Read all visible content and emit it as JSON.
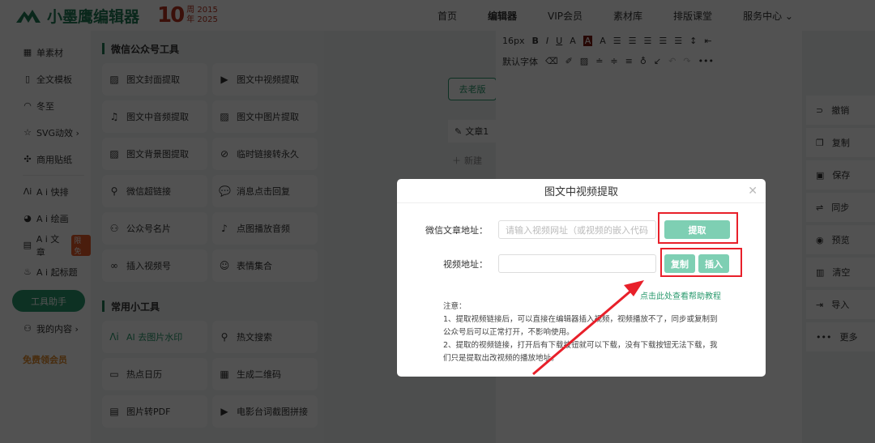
{
  "header": {
    "brand": "小墨鹰编辑器",
    "anniv_number": "10",
    "anniv_top": "周 2015",
    "anniv_bottom": "年 2025",
    "nav": [
      "首页",
      "编辑器",
      "VIP会员",
      "素材库",
      "排版课堂",
      "服务中心 ⌄"
    ]
  },
  "left_nav": {
    "items": [
      {
        "icon": "grid",
        "label": "单素材"
      },
      {
        "icon": "template",
        "label": "全文模板"
      },
      {
        "icon": "dumpling",
        "label": "冬至"
      },
      {
        "icon": "star",
        "label": "SVG动效 ›"
      },
      {
        "icon": "puzzle",
        "label": "商用贴纸"
      }
    ],
    "ai_items": [
      {
        "icon": "ai",
        "label": "A i 快排"
      },
      {
        "icon": "palette",
        "label": "A i 绘画"
      },
      {
        "icon": "doc",
        "label": "A i 文章",
        "badge": "限免"
      },
      {
        "icon": "fire",
        "label": "A i 起标题"
      }
    ],
    "tool_helper": "工具助手",
    "my_content": "我的内容 ›",
    "free_vip": "免费领会员"
  },
  "tools": {
    "section1": "微信公众号工具",
    "items1": [
      "图文封面提取",
      "图文中视频提取",
      "图文中音频提取",
      "图文中图片提取",
      "图文背景图提取",
      "临时链接转永久",
      "微信超链接",
      "消息点击回复",
      "公众号名片",
      "点图播放音频",
      "插入视频号",
      "表情集合"
    ],
    "section2": "常用小工具",
    "items2": [
      "AI 去图片水印",
      "热文搜索",
      "热点日历",
      "生成二维码",
      "图片转PDF",
      "电影台词截图拼接"
    ]
  },
  "articles": {
    "old_version": "去老版",
    "article": "文章1",
    "new": "新建"
  },
  "toolbar": {
    "font_size": "16px",
    "font_family": "默认字体"
  },
  "right_actions": [
    "撤销",
    "复制",
    "保存",
    "同步",
    "预览",
    "清空",
    "导入",
    "更多"
  ],
  "dialog": {
    "title": "图文中视频提取",
    "label_url": "微信文章地址：",
    "placeholder_url": "请输入视频网址（或视频的嵌入代码",
    "btn_extract": "提取",
    "label_video": "视频地址：",
    "video_value": "",
    "btn_copy": "复制",
    "btn_insert": "插入",
    "help_link": "点击此处查看帮助教程",
    "notes": [
      "注意：",
      "1、提取视频链接后，可以直接在编辑器插入视频，视频播放不了，同步或复制到公众号后可以正常打开，不影响使用。",
      "2、提取的视频链接，打开后有下载按钮就可以下载，没有下载按钮无法下载，我们只是提取出改视频的播放地址。"
    ]
  },
  "colors": {
    "brand": "#1f7a55",
    "accent": "#2a9a6e",
    "button": "#7ecfb3",
    "highlight": "#e8202a"
  }
}
